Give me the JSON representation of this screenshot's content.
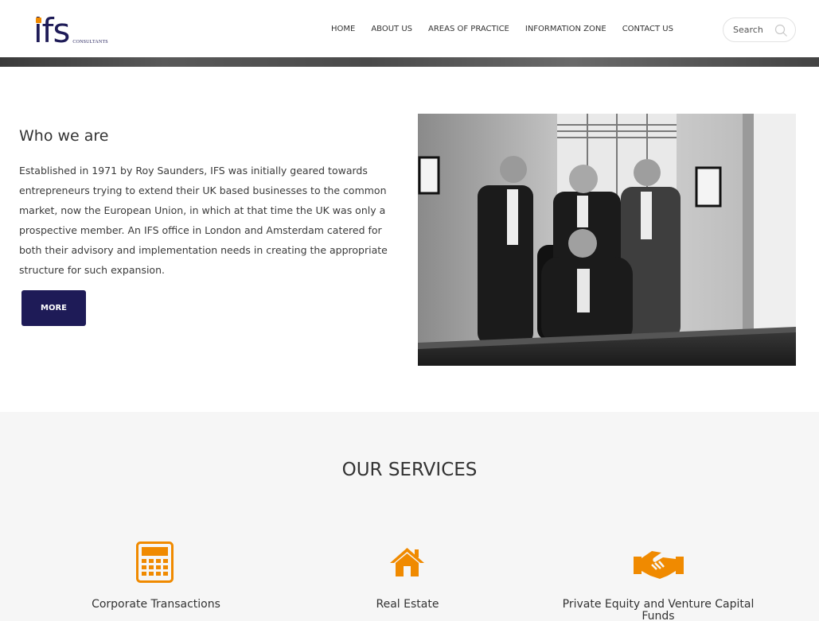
{
  "brand": {
    "logo_text": "ifs",
    "logo_sub": "CONSULTANTS",
    "accent": "#f08a00",
    "primary": "#1e1b57"
  },
  "nav": {
    "items": [
      "HOME",
      "ABOUT US",
      "AREAS OF PRACTICE",
      "INFORMATION ZONE",
      "CONTACT US"
    ]
  },
  "search": {
    "placeholder": "Search",
    "icon": "search-icon"
  },
  "about": {
    "title": "Who we are",
    "body": "Established in 1971 by Roy Saunders, IFS was initially geared towards entrepreneurs trying to extend their UK based businesses to the common market, now the European Union, in which at that time the UK was only a prospective member. An IFS office in London and Amsterdam catered for both their advisory and implementation needs in creating the appropriate structure for such expansion.",
    "button_label": "MORE",
    "photo": "team-photo"
  },
  "services": {
    "title": "OUR SERVICES",
    "items": [
      {
        "label": "Corporate Transactions",
        "icon": "calculator-icon"
      },
      {
        "label": "Real Estate",
        "icon": "house-icon"
      },
      {
        "label": "Private Equity and Venture Capital Funds",
        "icon": "handshake-icon"
      }
    ]
  }
}
